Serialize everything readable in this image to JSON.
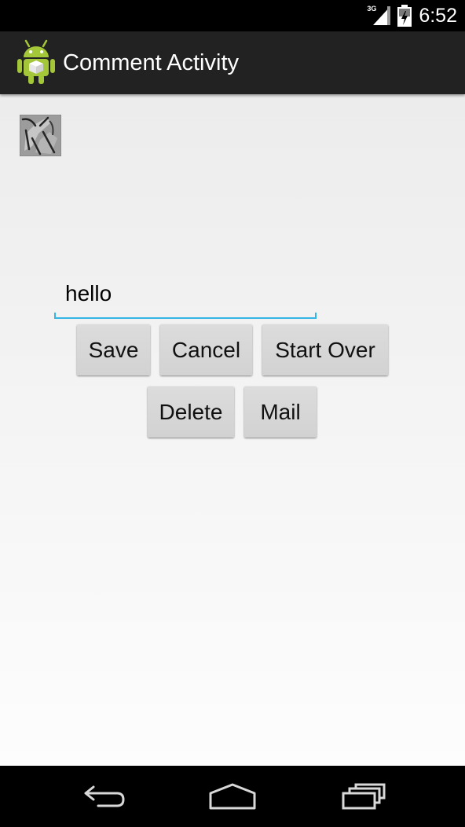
{
  "status_bar": {
    "network_type": "3G",
    "time": "6:52",
    "icons": [
      "signal-icon",
      "battery-icon"
    ]
  },
  "action_bar": {
    "title": "Comment Activity",
    "icon": "android-app-icon",
    "background": "#222222"
  },
  "content": {
    "thumbnail_icon": "photo-thumbnail",
    "comment_input": {
      "value": "hello",
      "placeholder": ""
    },
    "buttons": {
      "save": "Save",
      "cancel": "Cancel",
      "start_over": "Start Over",
      "delete": "Delete",
      "mail": "Mail"
    },
    "accent_color": "#33b5e5"
  },
  "nav_bar": {
    "icons": [
      "back-icon",
      "home-icon",
      "recent-apps-icon"
    ]
  }
}
